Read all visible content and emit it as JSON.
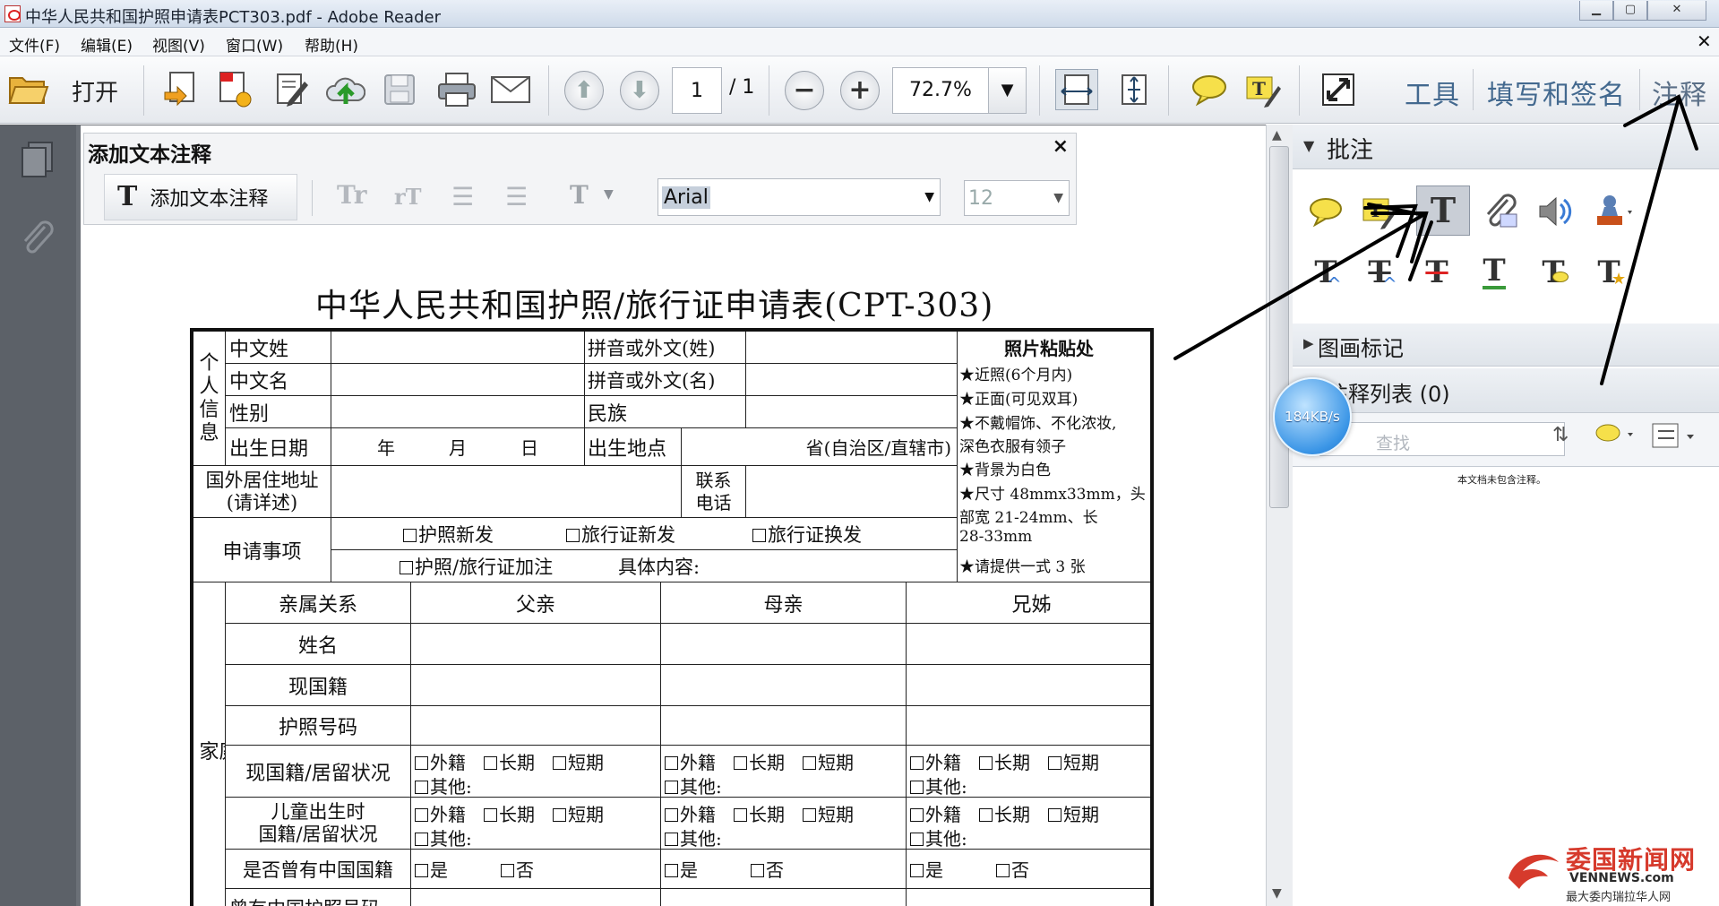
{
  "window": {
    "title": "中华人民共和国护照申请表PCT303.pdf - Adobe Reader",
    "min": "▁",
    "max": "▢",
    "close": "✕"
  },
  "menu": [
    "文件(F)",
    "编辑(E)",
    "视图(V)",
    "窗口(W)",
    "帮助(H)"
  ],
  "menu_close": "✕",
  "toolbar": {
    "open_label": "打开",
    "page_current": "1",
    "page_total": "/ 1",
    "zoom": "72.7%",
    "tools": "工具",
    "fill_sign": "填写和签名",
    "comment": "注释"
  },
  "annot_panel": {
    "title": "添加文本注释",
    "close": "×",
    "add_text_label": "添加文本注释",
    "font": "Arial",
    "size": "12"
  },
  "right_pane": {
    "annotations": "批注",
    "drawing_markup": "图画标记",
    "comment_list": "注释列表 (0)",
    "search_placeholder": "查找",
    "no_comments": "本文档未包含注释。",
    "speed_badge": "184KB/s"
  },
  "form": {
    "title": "中华人民共和国护照/旅行证申请表(CPT-303)",
    "personal_section": "个人信息",
    "labels": {
      "cn_surname": "中文姓",
      "py_surname": "拼音或外文(姓)",
      "cn_name": "中文名",
      "py_name": "拼音或外文(名)",
      "gender": "性别",
      "ethnic": "民族",
      "birth_date": "出生日期",
      "date_text": "年　　　月　　　日",
      "birth_place": "出生地点",
      "place_text": "省(自治区/直辖市)",
      "addr1": "国外居住地址",
      "addr2": "(请详述)",
      "contact1": "联系",
      "contact2": "电话",
      "request": "申请事项",
      "opt1": "护照新发",
      "opt2": "旅行证新发",
      "opt3": "旅行证换发",
      "opt4": "护照/旅行证加注",
      "detail": "具体内容:"
    },
    "photo": {
      "title": "照片粘贴处",
      "lines": [
        "★近照(6个月内)",
        "★正面(可见双耳)",
        "★不戴帽饰、不化浓妆,",
        "深色衣服有领子",
        "★背景为白色",
        "★尺寸 48mmx33mm，头",
        "部宽 21-24mm、长",
        "28-33mm",
        "★请提供一式 3 张"
      ]
    },
    "family_section": "家庭成员",
    "family_headers": [
      "亲属关系",
      "父亲",
      "母亲",
      "兄姊"
    ],
    "family_rows": [
      "姓名",
      "现国籍",
      "护照号码",
      "现国籍/居留状况",
      "儿童出生时",
      "国籍/居留状况",
      "是否曾有中国国籍",
      "曾有中国护照号码"
    ],
    "status_opts": {
      "foreign": "外籍",
      "long": "长期",
      "short": "短期",
      "other": "其他:"
    },
    "yes": "是",
    "no": "否"
  },
  "watermark": {
    "brand": "委国新闻网",
    "url": "VENNEWS.com",
    "slogan": "最大委内瑞拉华人网"
  }
}
